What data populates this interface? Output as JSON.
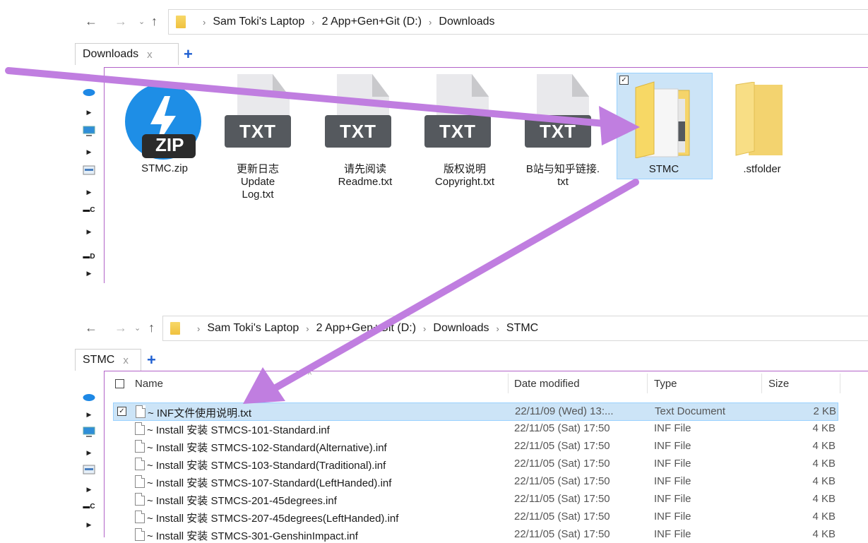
{
  "window1": {
    "breadcrumbs": [
      "Sam Toki's Laptop",
      "2 App+Gen+Git (D:)",
      "Downloads"
    ],
    "tab_label": "Downloads",
    "files": [
      {
        "name_lines": [
          "STMC.zip"
        ],
        "kind": "zip",
        "badge": "ZIP"
      },
      {
        "name_lines": [
          "更新日志",
          "Update",
          "Log.txt"
        ],
        "kind": "txt",
        "badge": "TXT"
      },
      {
        "name_lines": [
          "请先阅读",
          "Readme.txt"
        ],
        "kind": "txt",
        "badge": "TXT"
      },
      {
        "name_lines": [
          "版权说明",
          "Copyright.txt"
        ],
        "kind": "txt",
        "badge": "TXT"
      },
      {
        "name_lines": [
          "B站与知乎链接.",
          "txt"
        ],
        "kind": "txt",
        "badge": "TXT"
      },
      {
        "name_lines": [
          "STMC"
        ],
        "kind": "folder",
        "selected": true
      },
      {
        "name_lines": [
          ".stfolder"
        ],
        "kind": "folder"
      }
    ]
  },
  "window2": {
    "breadcrumbs": [
      "Sam Toki's Laptop",
      "2 App+Gen+Git (D:)",
      "Downloads",
      "STMC"
    ],
    "tab_label": "STMC",
    "columns": {
      "name": "Name",
      "date": "Date modified",
      "type": "Type",
      "size": "Size"
    },
    "rows": [
      {
        "name": "~ INF文件使用说明.txt",
        "date": "22/11/09 (Wed) 13:...",
        "type": "Text Document",
        "size": "2 KB",
        "selected": true
      },
      {
        "name": "~ Install 安装 STMCS-101-Standard.inf",
        "date": "22/11/05 (Sat) 17:50",
        "type": "INF File",
        "size": "4 KB"
      },
      {
        "name": "~ Install 安装 STMCS-102-Standard(Alternative).inf",
        "date": "22/11/05 (Sat) 17:50",
        "type": "INF File",
        "size": "4 KB"
      },
      {
        "name": "~ Install 安装 STMCS-103-Standard(Traditional).inf",
        "date": "22/11/05 (Sat) 17:50",
        "type": "INF File",
        "size": "4 KB"
      },
      {
        "name": "~ Install 安装 STMCS-107-Standard(LeftHanded).inf",
        "date": "22/11/05 (Sat) 17:50",
        "type": "INF File",
        "size": "4 KB"
      },
      {
        "name": "~ Install 安装 STMCS-201-45degrees.inf",
        "date": "22/11/05 (Sat) 17:50",
        "type": "INF File",
        "size": "4 KB"
      },
      {
        "name": "~ Install 安装 STMCS-207-45degrees(LeftHanded).inf",
        "date": "22/11/05 (Sat) 17:50",
        "type": "INF File",
        "size": "4 KB"
      },
      {
        "name": "~ Install 安装 STMCS-301-GenshinImpact.inf",
        "date": "22/11/05 (Sat) 17:50",
        "type": "INF File",
        "size": "4 KB"
      }
    ]
  },
  "nav": {
    "back": "←",
    "forward": "→",
    "recent": "⌄",
    "up": "↑",
    "tab_close": "x",
    "tab_add": "+"
  },
  "drives": {
    "c": "C",
    "d": "D"
  },
  "colors": {
    "annotation_arrow": "#c07ee0",
    "selection": "#cce4f7",
    "folder": "#f5cf5a",
    "txt_badge": "#55595e",
    "zip_blue": "#1e8ee6"
  }
}
